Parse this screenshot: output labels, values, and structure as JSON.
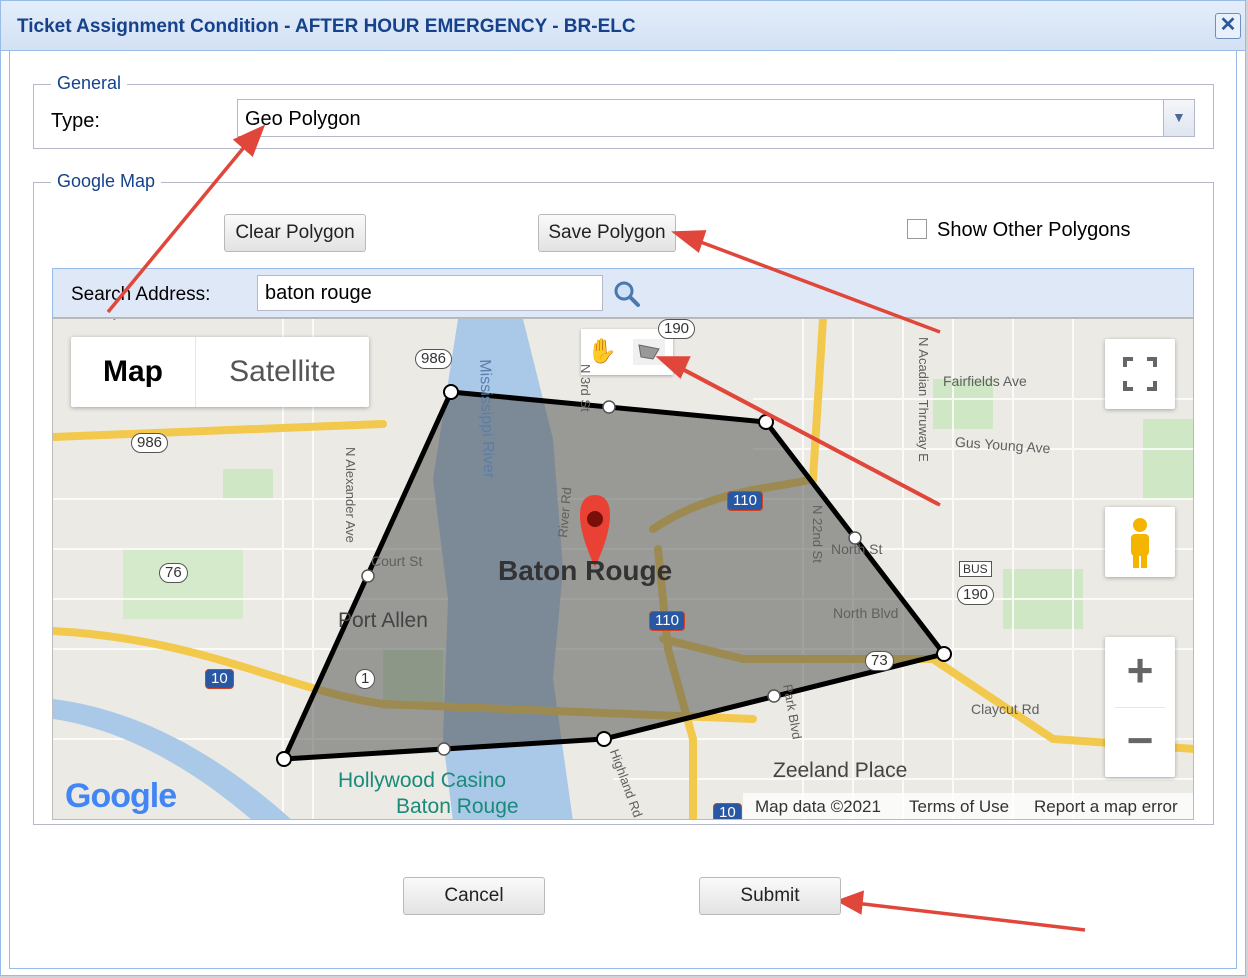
{
  "window": {
    "title": "Ticket Assignment Condition - AFTER HOUR EMERGENCY - BR-ELC",
    "close_symbol": "✕"
  },
  "general": {
    "legend": "General",
    "type_label": "Type:",
    "type_value": "Geo Polygon"
  },
  "google_map": {
    "legend": "Google Map",
    "clear_label": "Clear Polygon",
    "save_label": "Save Polygon",
    "show_other_label": "Show Other Polygons",
    "search_label": "Search Address:",
    "search_value": "baton rouge"
  },
  "map": {
    "type_map": "Map",
    "type_satellite": "Satellite",
    "city": "Baton Rouge",
    "labels": {
      "port_allen": "Port Allen",
      "zeeland": "Zeeland Place",
      "casino_1": "Hollywood Casino",
      "casino_2": "Baton Rouge",
      "river": "Mississippi River",
      "fairfields": "Fairfields Ave",
      "gus_young": "Gus Young Ave",
      "north_st": "North St",
      "north_blvd": "North Blvd",
      "claycut": "Claycut Rd",
      "court_st": "Court St",
      "n_alexander": "N Alexander Ave",
      "n_acadian": "N Acadian Thruway E",
      "n_22nd": "N 22nd St",
      "river_rd": "River Rd",
      "n_3rd": "N 3rd St",
      "park_blvd": "Park Blvd",
      "highland": "Highland Rd"
    },
    "shields": [
      "190",
      "986",
      "986",
      "76",
      "110",
      "110",
      "190",
      "73",
      "10",
      "1",
      "10"
    ],
    "bus_label": "BUS",
    "attribution": "Map data ©2021",
    "terms": "Terms of Use",
    "report": "Report a map error",
    "google_logo": "Google",
    "zoom_in": "+",
    "zoom_out": "−"
  },
  "footer": {
    "cancel_label": "Cancel",
    "submit_label": "Submit"
  },
  "colors": {
    "title_text": "#15428b",
    "annotation_arrow": "#e0473a",
    "polygon_fill": "#555555",
    "highway": "#f2c94c"
  }
}
